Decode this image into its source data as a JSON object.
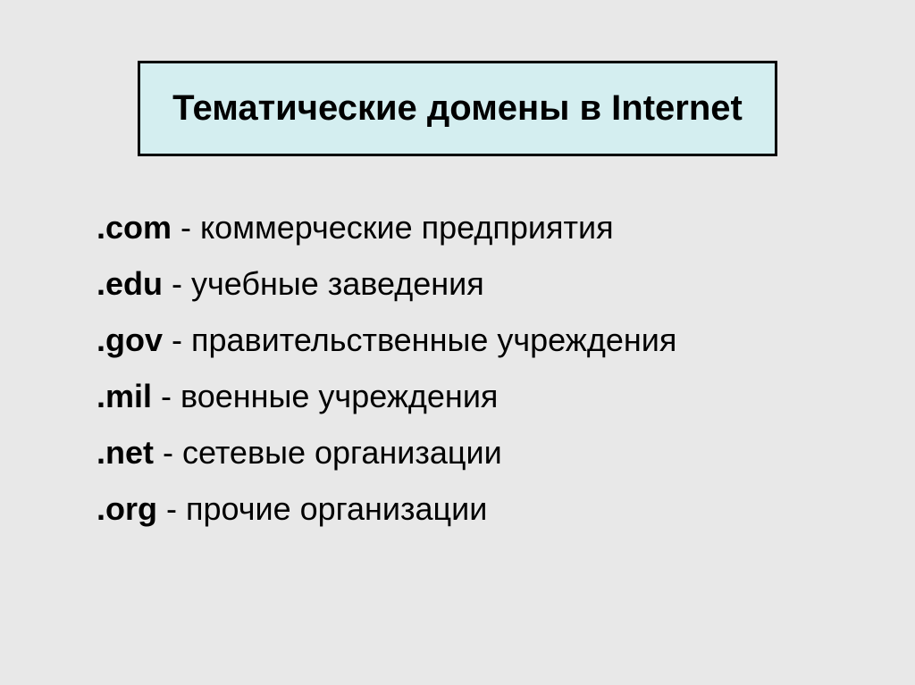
{
  "title": "Тематические домены в Internet",
  "domains": {
    "item0": {
      "name": ".com",
      "desc": " - коммерческие предприятия"
    },
    "item1": {
      "name": ".edu",
      "desc": " - учебные заведения"
    },
    "item2": {
      "name": ".gov",
      "desc": " - правительственные учреждения"
    },
    "item3": {
      "name": ".mil",
      "desc": " - военные учреждения"
    },
    "item4": {
      "name": ".net",
      "desc": " - сетевые организации"
    },
    "item5": {
      "name": ".org",
      "desc": " - прочие организации"
    }
  }
}
